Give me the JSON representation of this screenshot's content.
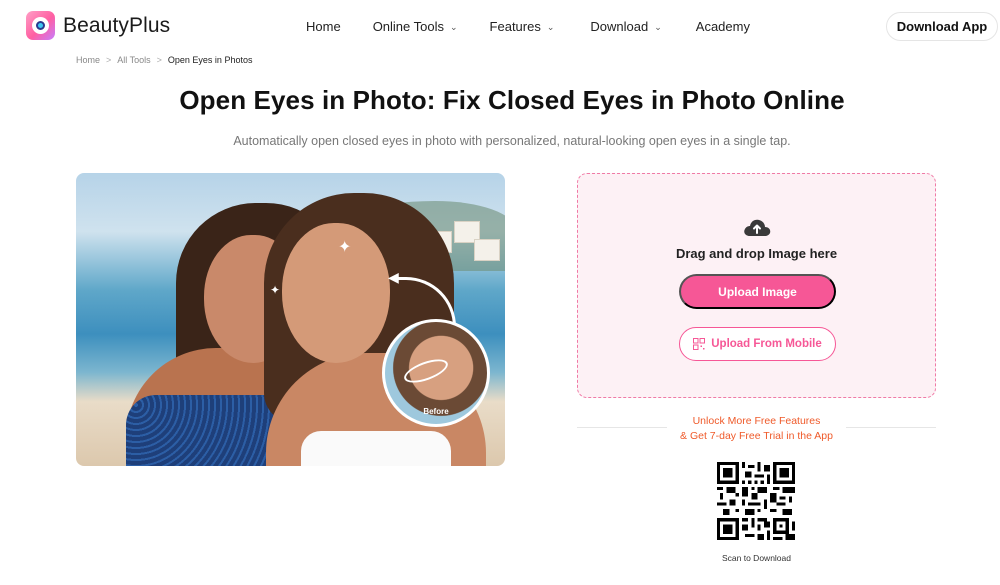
{
  "header": {
    "brand": "BeautyPlus",
    "nav": [
      {
        "label": "Home",
        "has_dropdown": false
      },
      {
        "label": "Online Tools",
        "has_dropdown": true
      },
      {
        "label": "Features",
        "has_dropdown": true
      },
      {
        "label": "Download",
        "has_dropdown": true
      },
      {
        "label": "Academy",
        "has_dropdown": false
      }
    ],
    "cta_label": "Download App"
  },
  "breadcrumb": {
    "items": [
      "Home",
      "All Tools",
      "Open Eyes in Photos"
    ]
  },
  "main": {
    "title": "Open Eyes in Photo: Fix Closed Eyes in Photo Online",
    "subtitle": "Automatically open closed eyes in photo with personalized, natural-looking open eyes in a single tap.",
    "hero": {
      "before_label": "Before"
    },
    "upload": {
      "drop_text": "Drag and drop Image here",
      "upload_button": "Upload Image",
      "mobile_button": "Upload From Mobile"
    },
    "promo": {
      "line1": "Unlock More Free Features",
      "line2": "& Get 7-day Free Trial in the App"
    },
    "qr": {
      "label": "Scan to Download"
    }
  },
  "colors": {
    "accent": "#f65796",
    "upload_bg": "#fdf1f5",
    "promo_text": "#ef5a2a"
  }
}
